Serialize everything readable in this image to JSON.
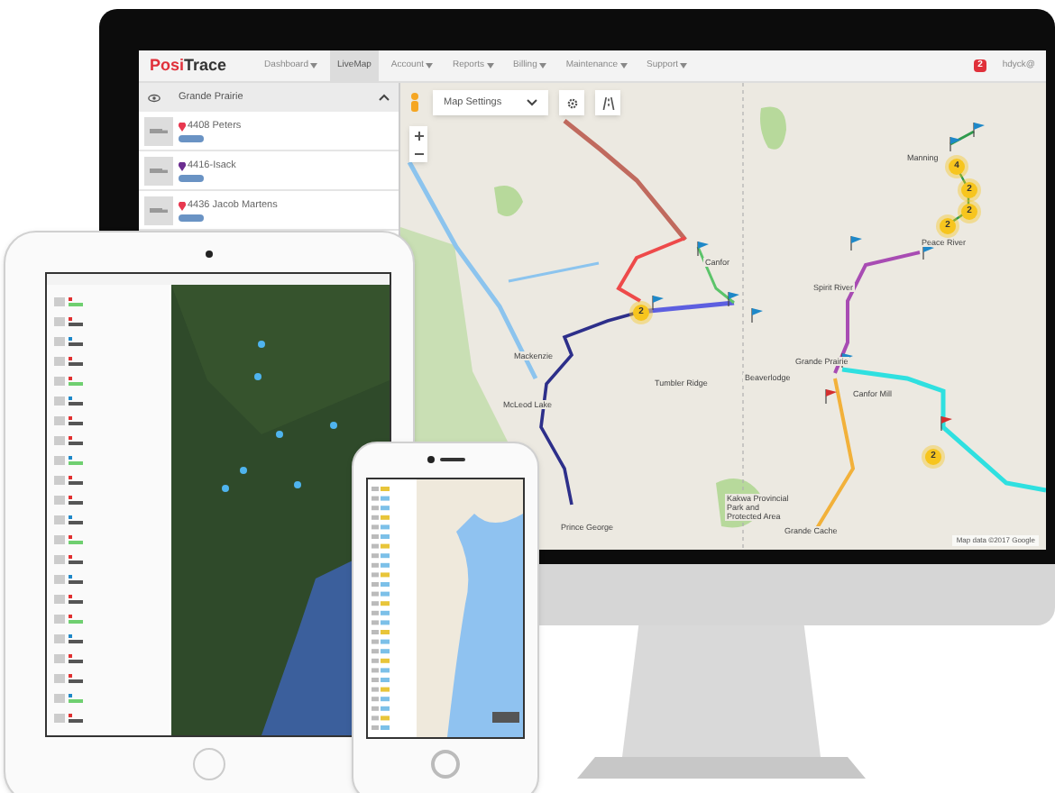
{
  "app": {
    "logo": {
      "first": "Posi",
      "second": "Trace"
    },
    "menu": [
      {
        "label": "Dashboard",
        "dropdown": true,
        "selected": false
      },
      {
        "label": "LiveMap",
        "dropdown": false,
        "selected": true
      },
      {
        "label": "Account",
        "dropdown": true,
        "selected": false
      },
      {
        "label": "Reports",
        "dropdown": true,
        "selected": false
      },
      {
        "label": "Billing",
        "dropdown": true,
        "selected": false
      },
      {
        "label": "Maintenance",
        "dropdown": true,
        "selected": false
      },
      {
        "label": "Support",
        "dropdown": true,
        "selected": false
      }
    ],
    "alerts_badge": "2",
    "user": "hdyck@"
  },
  "sidebar": {
    "group": "Grande Prairie",
    "expanded": true,
    "vehicles": [
      {
        "name": "4408 Peters",
        "color": "#e8384f"
      },
      {
        "name": "4416-Isack",
        "color": "#6b2d90"
      },
      {
        "name": "4436 Jacob Martens",
        "color": "#e8384f"
      }
    ]
  },
  "map": {
    "settings_label": "Map Settings",
    "labels": [
      "Manning",
      "Peace River",
      "Spirit River",
      "Canfor",
      "Mackenzie",
      "Tumbler Ridge",
      "Beaverlodge",
      "Grande Prairie",
      "Canfor Mill",
      "McLeod Lake",
      "Kakwa Provincial Park and Protected Area",
      "Prince George",
      "Grande Cache"
    ],
    "clusters": [
      "2",
      "4",
      "2",
      "2",
      "2",
      "2"
    ],
    "attribution": "Map data ©2017 Google"
  }
}
